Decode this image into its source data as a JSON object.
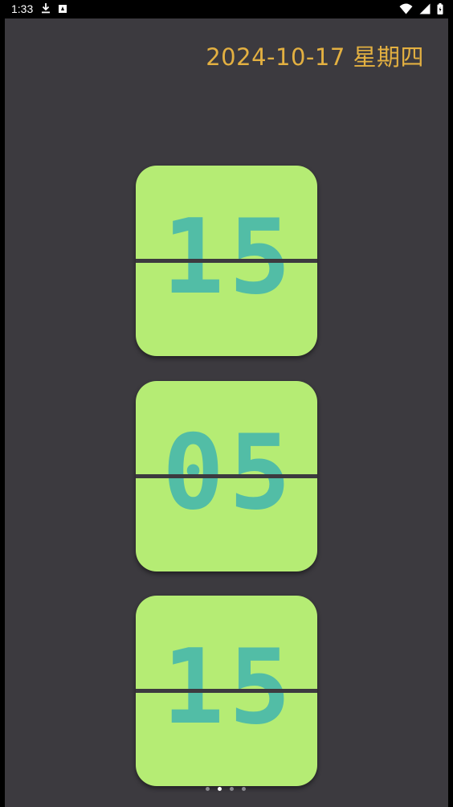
{
  "status_bar": {
    "time": "1:33",
    "icons": [
      "download-icon",
      "a-notification-icon",
      "wifi-icon",
      "signal-icon",
      "battery-icon"
    ]
  },
  "date": "2024-10-17 星期四",
  "clock": {
    "hours": "15",
    "minutes": "05",
    "seconds": "15"
  },
  "pager": {
    "count": 4,
    "active_index": 1
  },
  "colors": {
    "background": "#3c3a3f",
    "card": "#b5ec74",
    "digits": "#52bda6",
    "date_text": "#e3b041"
  }
}
